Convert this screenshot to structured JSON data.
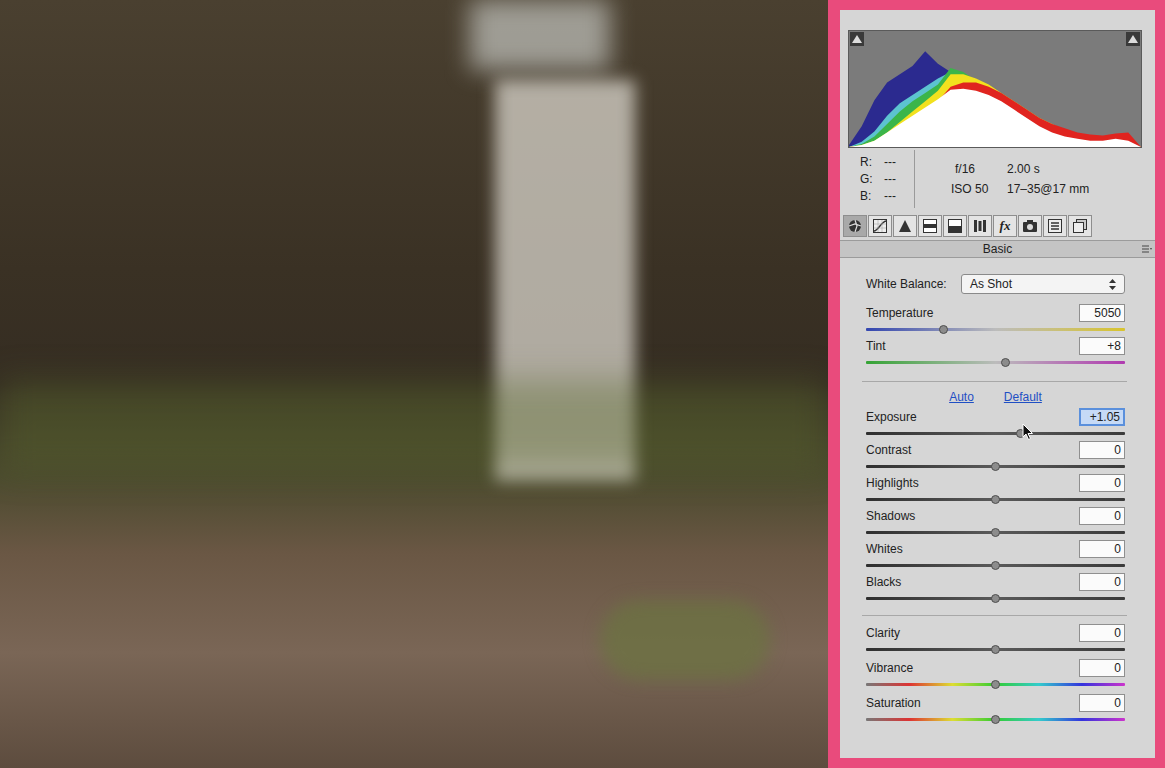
{
  "histogram": {
    "series": [
      {
        "name": "blue",
        "color": "#2b2a8f",
        "values": [
          2,
          20,
          45,
          62,
          70,
          78,
          92,
          80,
          72,
          62,
          54,
          46,
          40,
          34,
          28,
          22,
          17,
          13,
          10,
          8,
          7,
          8,
          12,
          0
        ]
      },
      {
        "name": "cyan",
        "color": "#5cc3d0",
        "values": [
          0,
          5,
          15,
          30,
          42,
          50,
          58,
          66,
          72,
          68,
          60,
          52,
          44,
          36,
          30,
          24,
          18,
          14,
          11,
          9,
          8,
          8,
          9,
          0
        ]
      },
      {
        "name": "green",
        "color": "#3bb54a",
        "values": [
          0,
          3,
          10,
          22,
          34,
          44,
          52,
          60,
          76,
          72,
          64,
          55,
          46,
          38,
          32,
          26,
          20,
          15,
          12,
          10,
          8,
          8,
          8,
          0
        ]
      },
      {
        "name": "yellow",
        "color": "#f2e11e",
        "values": [
          0,
          2,
          6,
          14,
          24,
          34,
          44,
          54,
          70,
          70,
          66,
          60,
          52,
          44,
          36,
          28,
          22,
          16,
          12,
          10,
          9,
          10,
          10,
          0
        ]
      },
      {
        "name": "red",
        "color": "#e0241f",
        "values": [
          0,
          1,
          4,
          10,
          18,
          26,
          34,
          44,
          58,
          62,
          62,
          58,
          52,
          44,
          36,
          28,
          22,
          18,
          14,
          12,
          11,
          13,
          14,
          0
        ]
      },
      {
        "name": "white",
        "color": "#ffffff",
        "values": [
          0,
          2,
          6,
          14,
          22,
          30,
          38,
          46,
          55,
          56,
          54,
          50,
          44,
          36,
          28,
          20,
          14,
          10,
          8,
          6,
          6,
          8,
          6,
          0
        ]
      }
    ]
  },
  "readout": {
    "rgb": [
      {
        "label": "R:",
        "value": "---"
      },
      {
        "label": "G:",
        "value": "---"
      },
      {
        "label": "B:",
        "value": "---"
      }
    ],
    "aperture": "f/16",
    "shutter": "2.00 s",
    "iso": "ISO 50",
    "lens": "17–35@17 mm"
  },
  "tabs": [
    {
      "kind": "basic",
      "selected": true
    },
    {
      "kind": "curve",
      "selected": false
    },
    {
      "kind": "detail",
      "selected": false
    },
    {
      "kind": "hsl",
      "selected": false
    },
    {
      "kind": "split",
      "selected": false
    },
    {
      "kind": "lens",
      "selected": false
    },
    {
      "kind": "fx",
      "label": "fx",
      "selected": false
    },
    {
      "kind": "camera",
      "selected": false
    },
    {
      "kind": "presets",
      "selected": false
    },
    {
      "kind": "snapshots",
      "selected": false
    }
  ],
  "panel": {
    "title": "Basic"
  },
  "white_balance": {
    "label": "White Balance:",
    "value": "As Shot"
  },
  "sections": [
    {
      "links": [],
      "sliders": [
        {
          "label": "Temperature",
          "value": "5050",
          "level": 0.3,
          "kind": "temperature",
          "focused": false
        },
        {
          "label": "Tint",
          "value": "+8",
          "level": 0.54,
          "kind": "tint",
          "focused": false
        }
      ]
    },
    {
      "links": [
        "Auto",
        "Default"
      ],
      "sliders": [
        {
          "label": "Exposure",
          "value": "+1.05",
          "level": 0.6,
          "kind": "tone",
          "focused": true
        },
        {
          "label": "Contrast",
          "value": "0",
          "level": 0.5,
          "kind": "tone",
          "focused": false
        },
        {
          "label": "Highlights",
          "value": "0",
          "level": 0.5,
          "kind": "tone",
          "focused": false
        },
        {
          "label": "Shadows",
          "value": "0",
          "level": 0.5,
          "kind": "tone",
          "focused": false
        },
        {
          "label": "Whites",
          "value": "0",
          "level": 0.5,
          "kind": "tone",
          "focused": false
        },
        {
          "label": "Blacks",
          "value": "0",
          "level": 0.5,
          "kind": "tone",
          "focused": false
        }
      ]
    },
    {
      "links": [],
      "sliders": [
        {
          "label": "Clarity",
          "value": "0",
          "level": 0.5,
          "kind": "tone",
          "focused": false
        },
        {
          "label": "Vibrance",
          "value": "0",
          "level": 0.5,
          "kind": "color",
          "focused": false
        },
        {
          "label": "Saturation",
          "value": "0",
          "level": 0.5,
          "kind": "color",
          "focused": false
        }
      ]
    }
  ]
}
